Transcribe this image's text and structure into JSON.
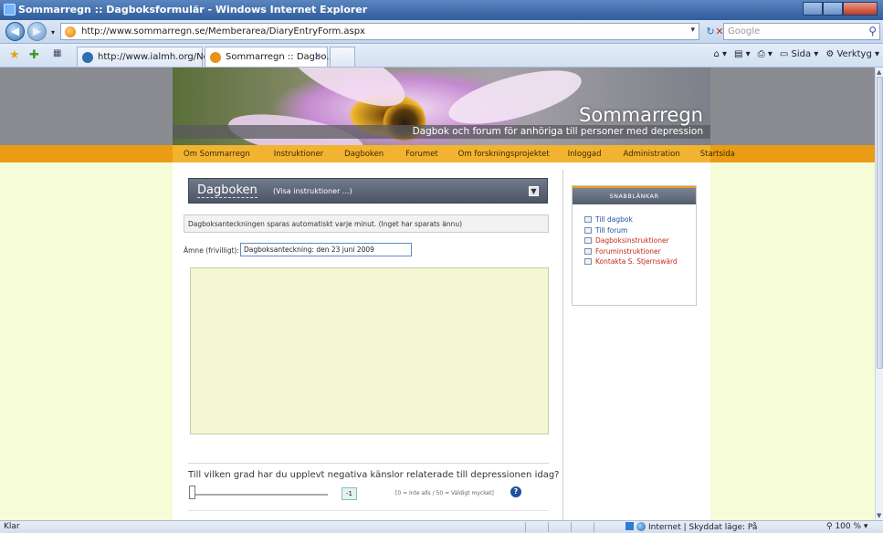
{
  "window": {
    "title": "Sommarregn :: Dagboksformulär - Windows Internet Explorer"
  },
  "address_bar": {
    "url": "http://www.sommarregn.se/Memberarea/DiaryEntryForm.aspx",
    "search_placeholder": "Google"
  },
  "tabs": [
    {
      "label": "http://www.ialmh.org/Ne...",
      "active": false
    },
    {
      "label": "Sommarregn :: Dagbo...",
      "active": true
    }
  ],
  "command_bar": {
    "page_label": "Sida",
    "tools_label": "Verktyg"
  },
  "site": {
    "title": "Sommarregn",
    "tagline": "Dagbok och forum för anhöriga till personer med depression"
  },
  "nav": [
    "Om Sommarregn",
    "Instruktioner",
    "Dagboken",
    "Forumet",
    "Om forskningsprojektet",
    "Inloggad",
    "Administration",
    "Startsida"
  ],
  "diary": {
    "title": "Dagboken",
    "instructions_link": "(Visa instruktioner ...)",
    "collapse_symbol": "▼",
    "autosave_note": "Dagboksanteckningen sparas automatiskt varje minut. (Inget har sparats ännu)",
    "subject_label": "Ämne (frivilligt):",
    "subject_value": "Dagboksanteckning: den 23 juni 2009",
    "entry_text": "",
    "question": "Till vilken grad har du upplevt negativa känslor relaterade till depressionen idag?",
    "slider_value": "-1",
    "scale_hint": "[0 = Inte alls / 50 = Väldigt mycket]",
    "help_symbol": "?"
  },
  "quick_links": {
    "title": "SNABBLÄNKAR",
    "items": [
      {
        "label": "Till dagbok",
        "color": "#1f4fa8"
      },
      {
        "label": "Till forum",
        "color": "#1f4fa8"
      },
      {
        "label": "Dagboksinstruktioner",
        "color": "#c42a1a"
      },
      {
        "label": "Foruminstruktioner",
        "color": "#c42a1a"
      },
      {
        "label": "Kontakta S. Stjernswärd",
        "color": "#c42a1a"
      }
    ]
  },
  "status_bar": {
    "status": "Klar",
    "zone": "Internet | Skyddat läge: På",
    "zoom": "100 %"
  },
  "colors": {
    "accent_orange": "#e99c14",
    "page_bg": "#f6fbd8",
    "header_gray": "#8b8b92"
  }
}
